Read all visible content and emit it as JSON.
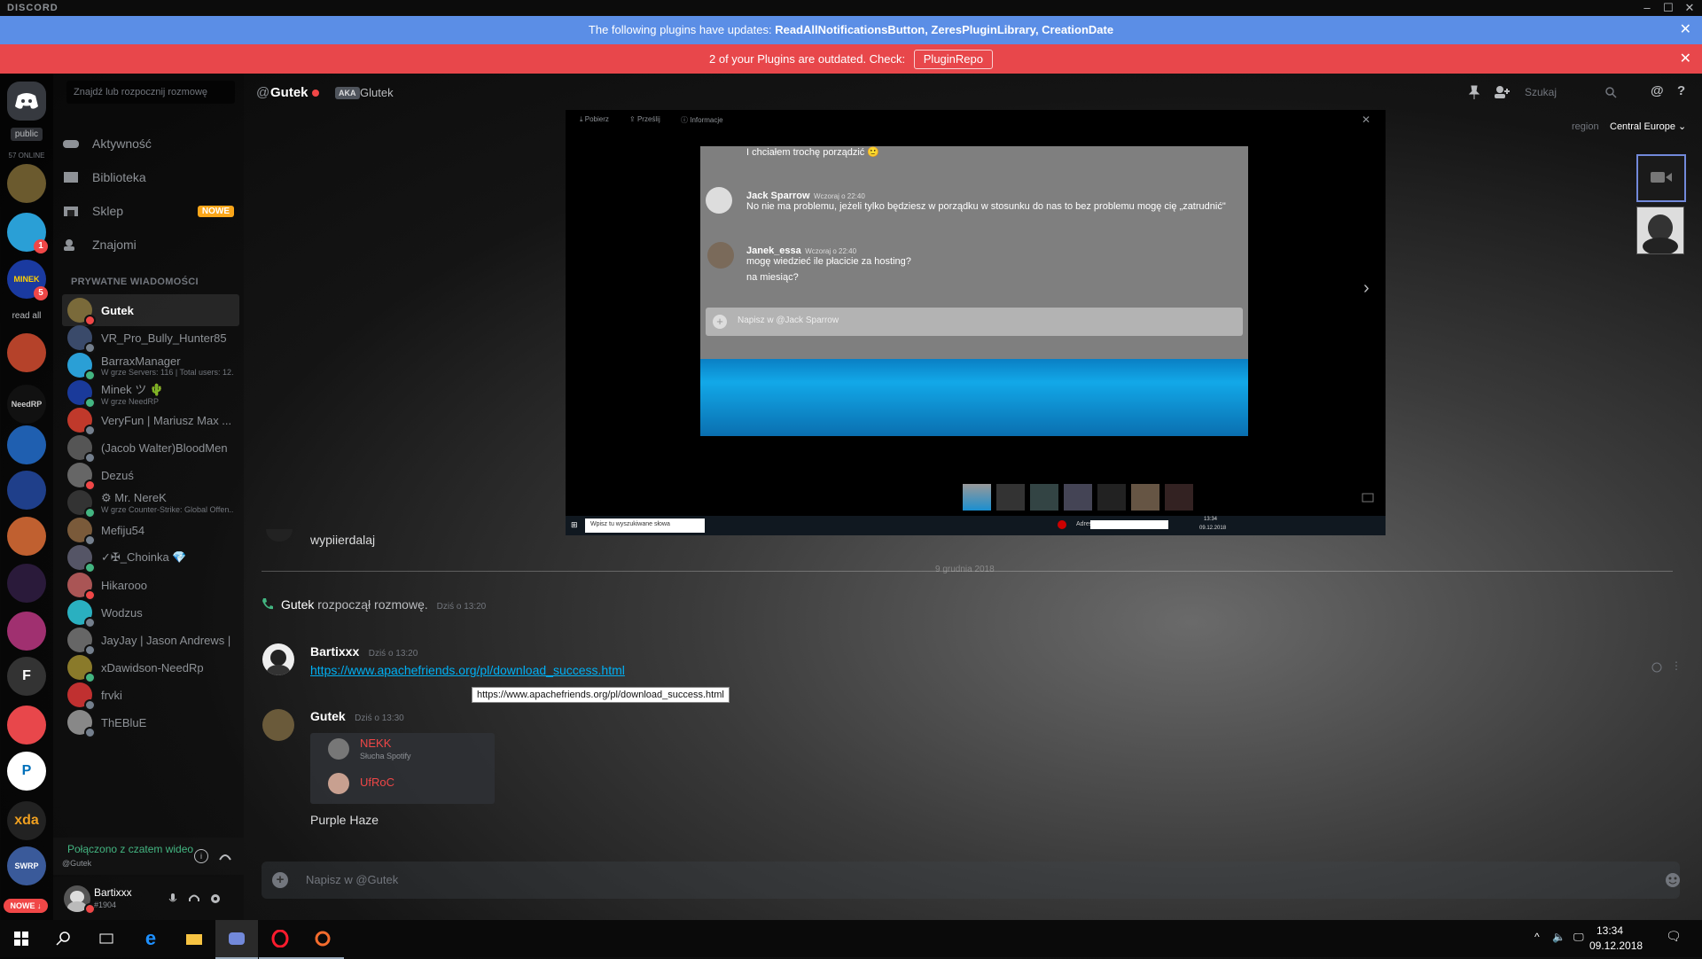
{
  "app": {
    "brand": "DISCORD"
  },
  "banners": {
    "updates_prefix": "The following plugins have updates: ",
    "updates_list": "ReadAllNotificationsButton, ZeresPluginLibrary, CreationDate",
    "outdated_text": "2 of your Plugins are outdated. Check:",
    "outdated_button": "PluginRepo"
  },
  "guilds": {
    "public_label": "public",
    "online_label": "57 ONLINE",
    "read_all": "read all",
    "new_badge": "NOWE ↓",
    "items": [
      {
        "name": "dog-server",
        "label": "",
        "badge": ""
      },
      {
        "name": "robot-server",
        "label": "",
        "badge": "1"
      },
      {
        "name": "minek-server",
        "label": "MINEK",
        "badge": "5"
      },
      {
        "name": "anime-server",
        "label": "",
        "badge": ""
      },
      {
        "name": "needrp-server",
        "label": "NeedRP",
        "badge": ""
      },
      {
        "name": "medical-server",
        "label": "",
        "badge": ""
      },
      {
        "name": "emblem-server",
        "label": "",
        "badge": ""
      },
      {
        "name": "character-server",
        "label": "",
        "badge": ""
      },
      {
        "name": "b-server",
        "label": "",
        "badge": ""
      },
      {
        "name": "character2-server",
        "label": "",
        "badge": ""
      },
      {
        "name": "f-server",
        "label": "F",
        "badge": ""
      },
      {
        "name": "flower-server",
        "label": "",
        "badge": ""
      },
      {
        "name": "paypal-server",
        "label": "P",
        "badge": ""
      },
      {
        "name": "xda-server",
        "label": "xda",
        "badge": ""
      },
      {
        "name": "swrp-server",
        "label": "SWRP",
        "badge": ""
      }
    ]
  },
  "sidebar": {
    "search_placeholder": "Znajdź lub rozpocznij rozmowę",
    "nav": [
      {
        "label": "Aktywność"
      },
      {
        "label": "Biblioteka"
      },
      {
        "label": "Sklep",
        "badge": "NOWE"
      },
      {
        "label": "Znajomi"
      }
    ],
    "dm_header": "PRYWATNE WIADOMOŚCI",
    "dms": [
      {
        "name": "Gutek",
        "sub": "",
        "status": "#f04747",
        "color": "#7a6a3a"
      },
      {
        "name": "VR_Pro_Bully_Hunter85",
        "sub": "",
        "status": "#747f8d",
        "color": "#3a4a6a"
      },
      {
        "name": "BarraxManager",
        "sub": "W grze Servers: 116 | Total users: 12...",
        "status": "#43b581",
        "color": "#2a9fd6"
      },
      {
        "name": "Minek ツ 🌵",
        "sub": "W grze NeedRP",
        "status": "#43b581",
        "color": "#1a3a9a"
      },
      {
        "name": "VeryFun | Mariusz Max ...",
        "sub": "",
        "status": "#747f8d",
        "color": "#c0392b"
      },
      {
        "name": "(Jacob Walter)BloodMen",
        "sub": "",
        "status": "#747f8d",
        "color": "#555"
      },
      {
        "name": "Dezuś",
        "sub": "",
        "status": "#f04747",
        "color": "#666"
      },
      {
        "name": "⚙ Mr. NereK",
        "sub": "W grze Counter-Strike: Global Offen...",
        "status": "#43b581",
        "color": "#333"
      },
      {
        "name": "Mefiju54",
        "sub": "",
        "status": "#747f8d",
        "color": "#7a5a3a"
      },
      {
        "name": "✓✠_Choinka 💎",
        "sub": "",
        "status": "#43b581",
        "color": "#556"
      },
      {
        "name": "Hikarooo",
        "sub": "",
        "status": "#f04747",
        "color": "#a55"
      },
      {
        "name": "Wodzus",
        "sub": "",
        "status": "#747f8d",
        "color": "#2ab0c0"
      },
      {
        "name": "JayJay | Jason Andrews |",
        "sub": "",
        "status": "#747f8d",
        "color": "#666"
      },
      {
        "name": "xDawidson-NeedRp",
        "sub": "",
        "status": "#43b581",
        "color": "#8a7a2a"
      },
      {
        "name": "frvki",
        "sub": "",
        "status": "#747f8d",
        "color": "#c03030"
      },
      {
        "name": "ThEBluE",
        "sub": "",
        "status": "#747f8d",
        "color": "#888"
      }
    ],
    "voice_status": "Połączono z czatem wideo",
    "voice_sub": "@Gutek",
    "user_name": "Bartixxx",
    "user_tag": "#1904"
  },
  "header": {
    "at": "@",
    "name": "Gutek",
    "aka_badge": "AKA",
    "aka_name": "Glutek",
    "search_placeholder": "Szukaj",
    "region_label": "region",
    "region_value": "Central Europe"
  },
  "viewer": {
    "toolbar": [
      "Pobierz",
      "Prześlij",
      "Informacje"
    ],
    "shot": {
      "top_text": "I chciałem trochę porządzić 🙂",
      "msg1_name": "Jack Sparrow",
      "msg1_time": "Wczoraj o 22:40",
      "msg1_text": "No nie ma problemu, jeżeli tylko będziesz w porządku w stosunku do nas to bez problemu mogę cię „zatrudnić\"",
      "msg2_name": "Janek_essa",
      "msg2_time": "Wczoraj o 22:40",
      "msg2_line1": "mogę wiedzieć ile płacicie za hosting?",
      "msg2_line2": "na miesiąc?",
      "input_placeholder": "Napisz w @Jack Sparrow"
    },
    "taskbar_search": "Wpisz tu wyszukiwane słowa",
    "taskbar_addr": "Adres",
    "taskbar_time": "13:34",
    "taskbar_date": "09.12.2018"
  },
  "messages": {
    "partial_text": "wypiierdalaj",
    "divider_date": "9 grudnia 2018",
    "system_name": "Gutek",
    "system_text": " rozpoczął rozmowę.",
    "system_time": "Dziś o 13:20",
    "m1_name": "Bartixxx",
    "m1_time": "Dziś o 13:20",
    "m1_link": "https://www.apachefriends.org/pl/download_success.html",
    "tooltip": "https://www.apachefriends.org/pl/download_success.html",
    "m2_name": "Gutek",
    "m2_time": "Dziś o 13:30",
    "embed_user1": "NEKK",
    "embed_user1_sub": "Słucha Spotify",
    "embed_user2": "UfRoC",
    "m2_text": "Purple Haze"
  },
  "composer": {
    "placeholder": "Napisz w @Gutek"
  },
  "taskbar": {
    "time": "13:34",
    "date": "09.12.2018"
  }
}
